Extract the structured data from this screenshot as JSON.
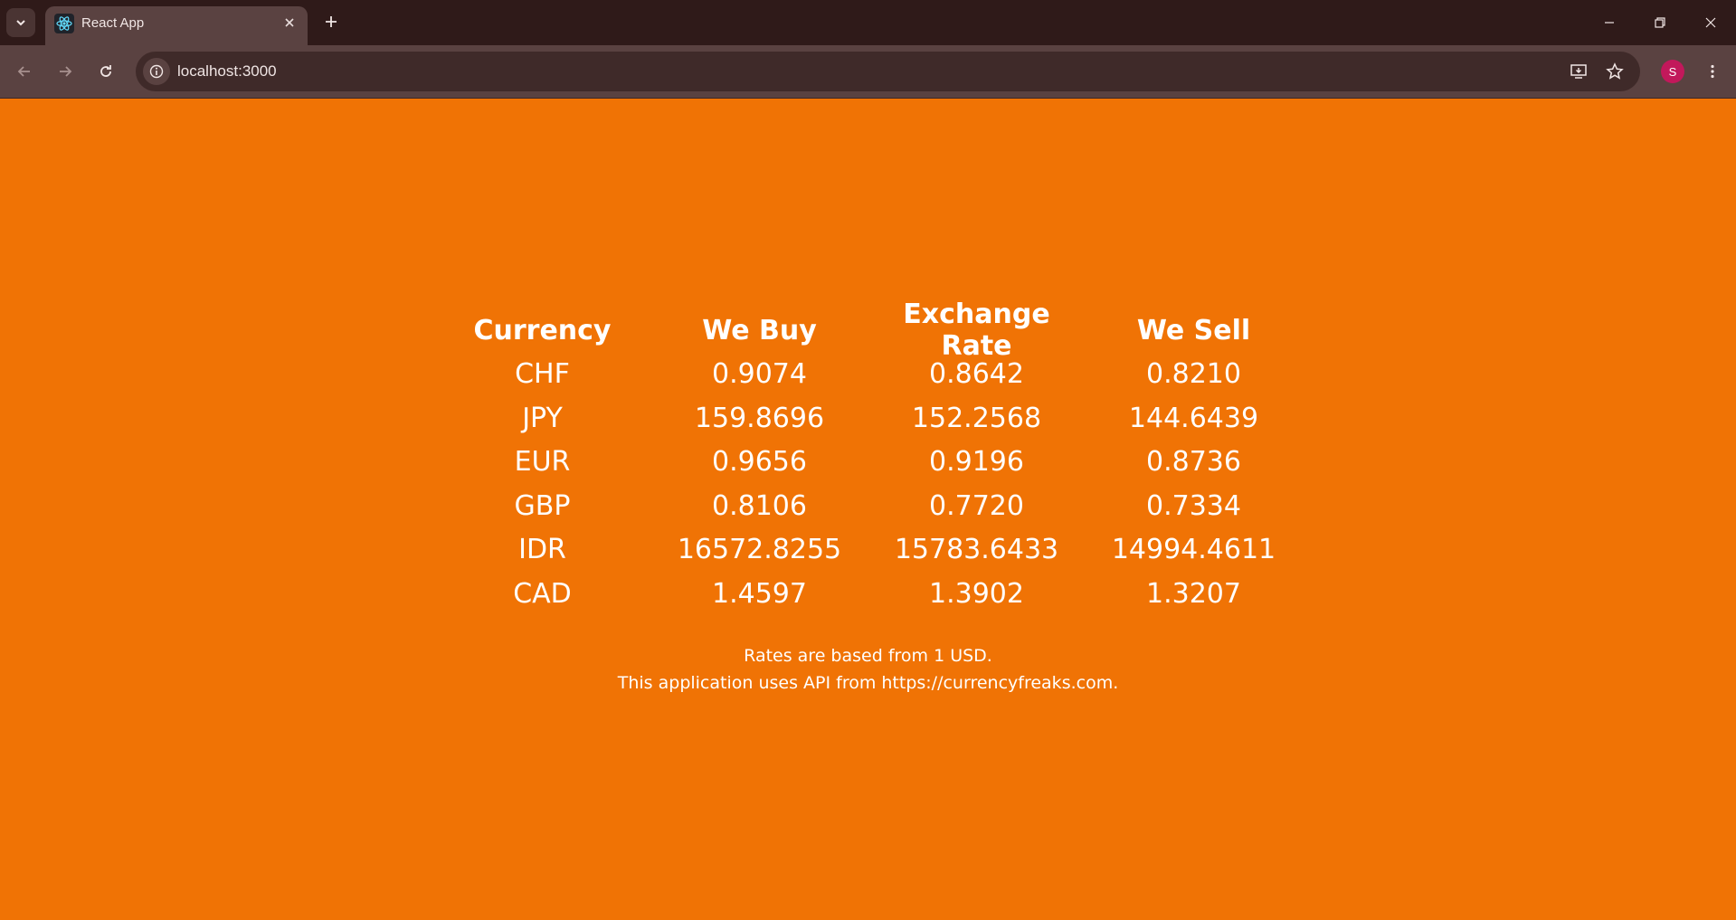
{
  "browser": {
    "tab_title": "React App",
    "url": "localhost:3000",
    "profile_initial": "S"
  },
  "table": {
    "headers": [
      "Currency",
      "We Buy",
      "Exchange Rate",
      "We Sell"
    ],
    "rows": [
      [
        "CHF",
        "0.9074",
        "0.8642",
        "0.8210"
      ],
      [
        "JPY",
        "159.8696",
        "152.2568",
        "144.6439"
      ],
      [
        "EUR",
        "0.9656",
        "0.9196",
        "0.8736"
      ],
      [
        "GBP",
        "0.8106",
        "0.7720",
        "0.7334"
      ],
      [
        "IDR",
        "16572.8255",
        "15783.6433",
        "14994.4611"
      ],
      [
        "CAD",
        "1.4597",
        "1.3902",
        "1.3207"
      ]
    ]
  },
  "footer": {
    "line1": "Rates are based from 1 USD.",
    "line2": "This application uses API from https://currencyfreaks.com."
  },
  "colors": {
    "page_background": "#f07305",
    "text": "#ffffff"
  }
}
